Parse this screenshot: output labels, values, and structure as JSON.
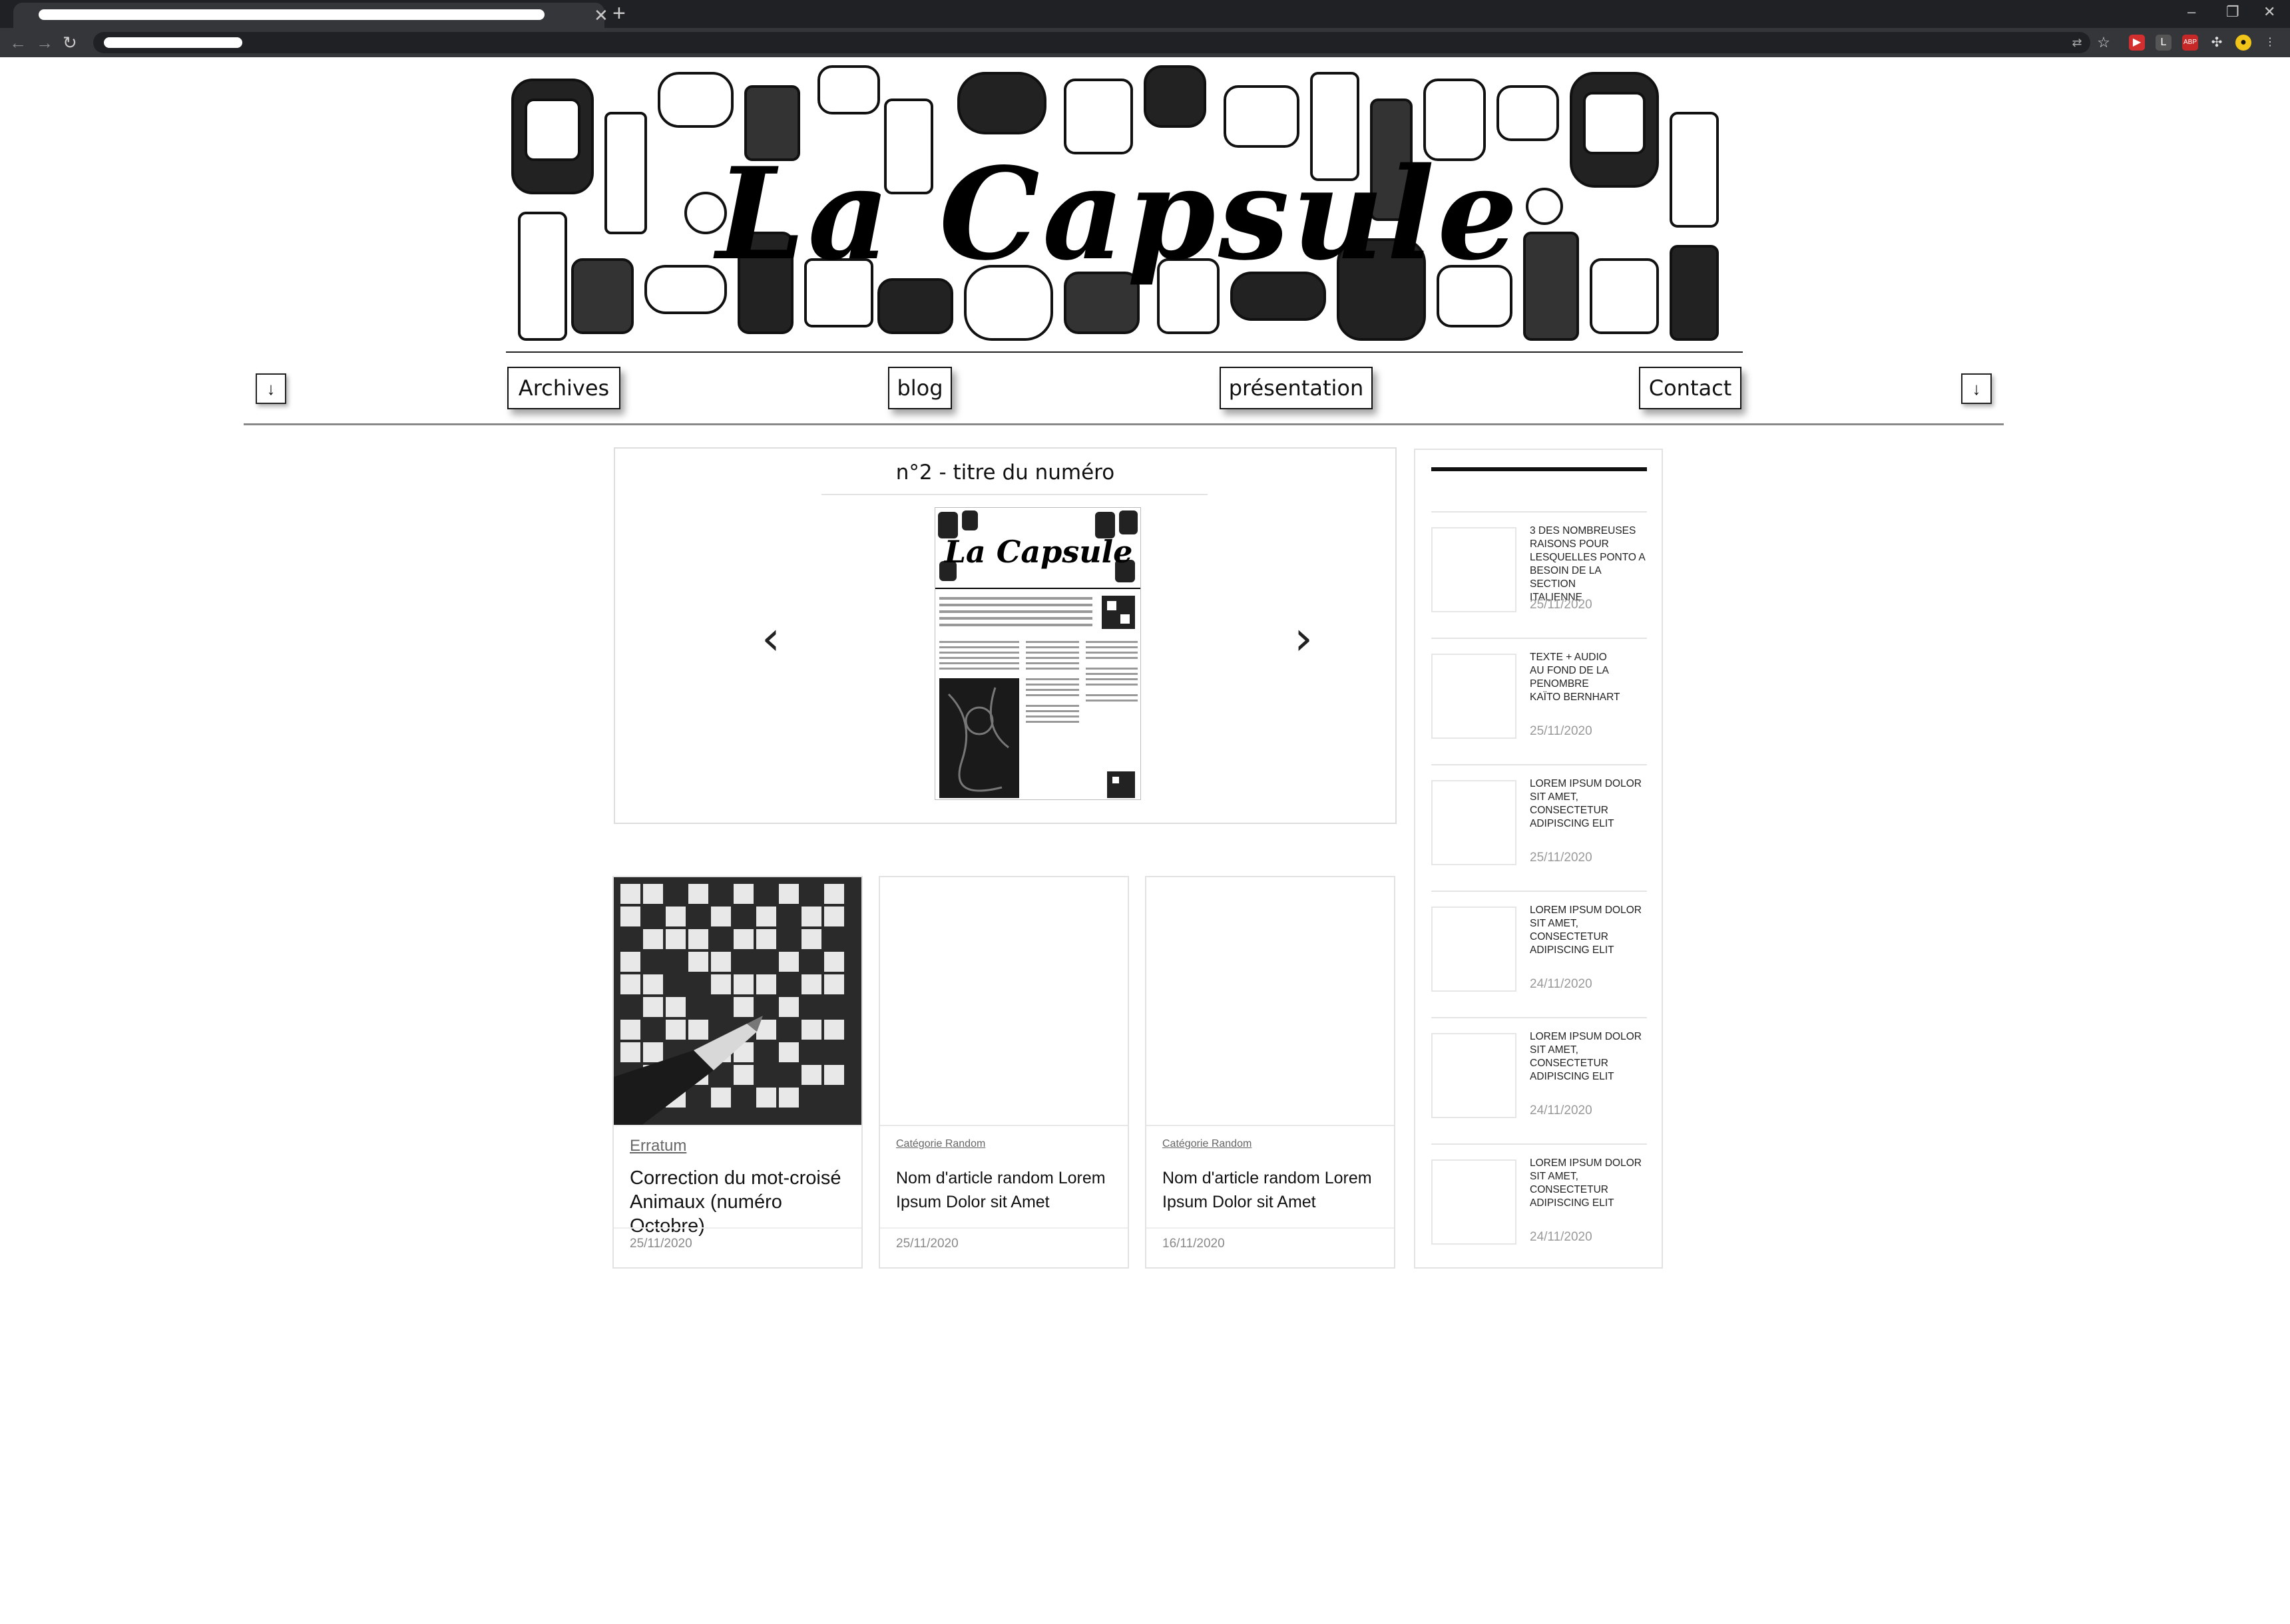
{
  "browser": {
    "tab_close_icon": "close-icon",
    "new_tab_icon": "plus-icon"
  },
  "site": {
    "logo_text": "La Capsule"
  },
  "nav": {
    "items": [
      {
        "label": "Archives"
      },
      {
        "label": "blog"
      },
      {
        "label": "présentation"
      },
      {
        "label": "Contact"
      }
    ],
    "left_arrow_icon": "arrow-down-icon",
    "right_arrow_icon": "arrow-down-icon"
  },
  "carousel": {
    "title": "n°2 - titre du numéro",
    "prev_icon": "chevron-left-icon",
    "next_icon": "chevron-right-icon",
    "cover_text": "La Capsule"
  },
  "cards": [
    {
      "category": "Erratum",
      "title": "Correction du mot-croisé Animaux (numéro Octobre)",
      "date": "25/11/2020"
    },
    {
      "category": "Catégorie Random",
      "title": "Nom d'article random Lorem Ipsum Dolor sit Amet",
      "date": "25/11/2020"
    },
    {
      "category": "Catégorie Random",
      "title": "Nom d'article random Lorem Ipsum Dolor sit Amet",
      "date": "16/11/2020"
    }
  ],
  "sidebar": {
    "items": [
      {
        "title": "3 DES NOMBREUSES\nRAISONS POUR\nLESQUELLES PONTO A\nBESOIN DE LA SECTION\nITALIENNE",
        "date": "25/11/2020"
      },
      {
        "title": "TEXTE + AUDIO\nAU FOND DE LA PENOMBRE\nKAÏTO BERNHART",
        "date": "25/11/2020"
      },
      {
        "title": "LOREM IPSUM DOLOR\nSIT AMET, CONSECTETUR\nADIPISCING ELIT",
        "date": "25/11/2020"
      },
      {
        "title": "LOREM IPSUM DOLOR\nSIT AMET, CONSECTETUR\nADIPISCING ELIT",
        "date": "24/11/2020"
      },
      {
        "title": "LOREM IPSUM DOLOR\nSIT AMET, CONSECTETUR\nADIPISCING ELIT",
        "date": "24/11/2020"
      },
      {
        "title": "LOREM IPSUM DOLOR\nSIT AMET, CONSECTETUR\nADIPISCING ELIT",
        "date": "24/11/2020"
      }
    ]
  }
}
